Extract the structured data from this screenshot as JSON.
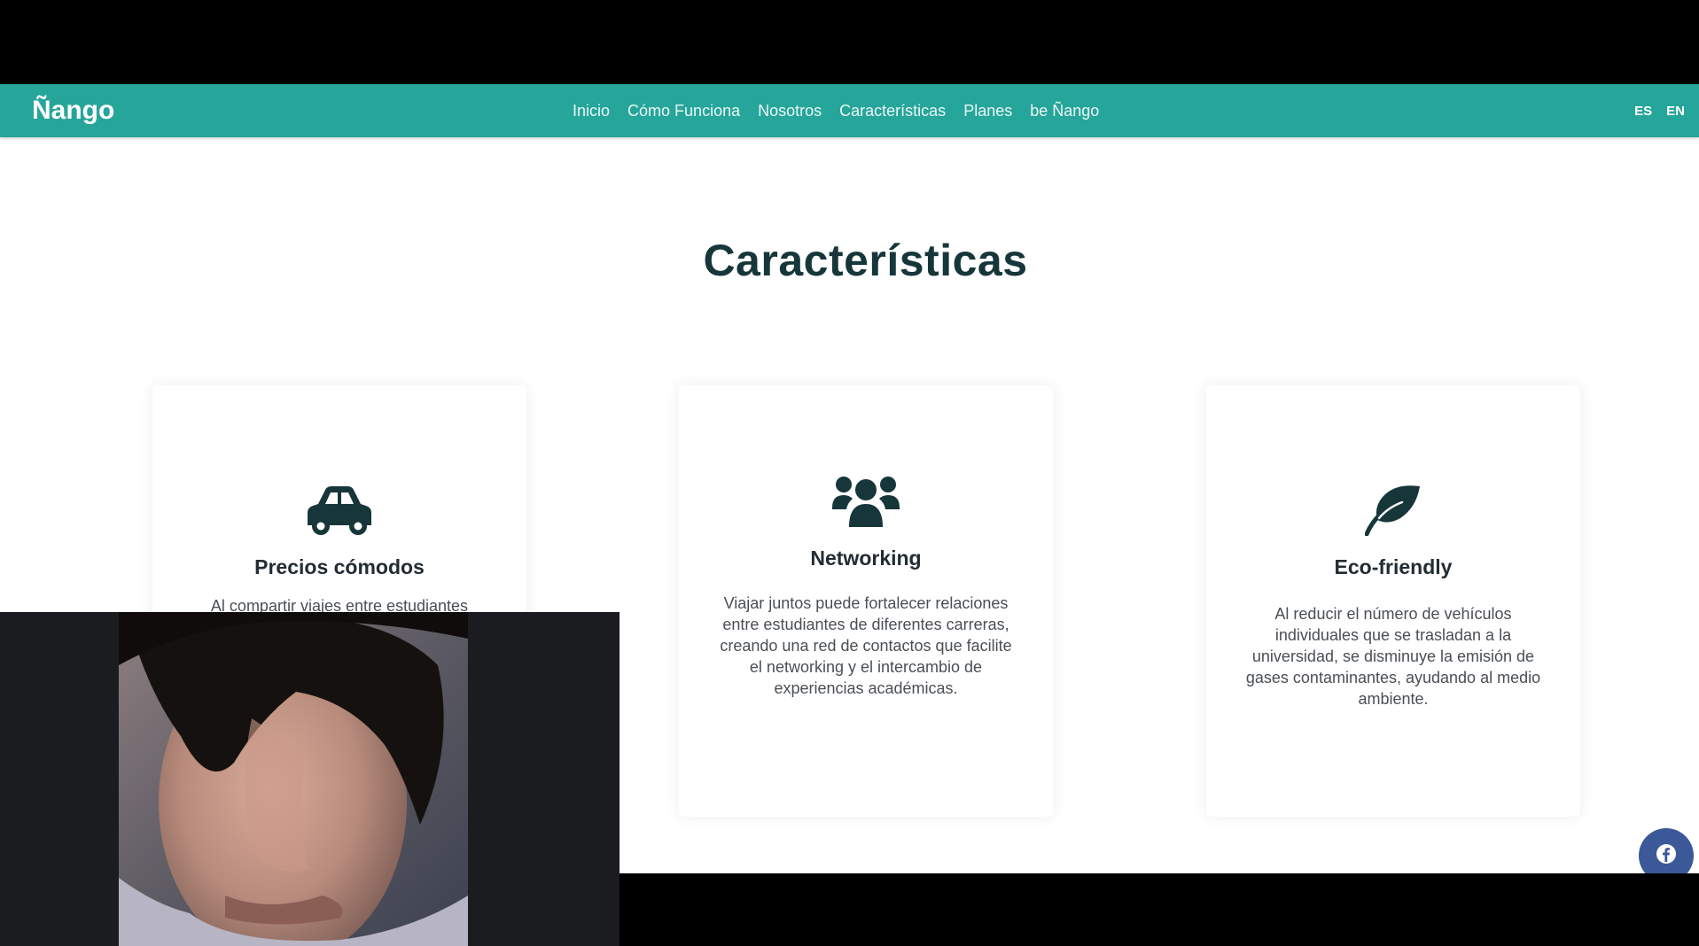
{
  "site": {
    "brand": "Ñango",
    "nav": [
      {
        "label": "Inicio"
      },
      {
        "label": "Cómo Funciona"
      },
      {
        "label": "Nosotros"
      },
      {
        "label": "Características"
      },
      {
        "label": "Planes"
      },
      {
        "label": "be Ñango"
      }
    ],
    "languages": [
      "ES",
      "EN"
    ],
    "accent_color": "#26a59a"
  },
  "features": {
    "title": "Características",
    "cards": [
      {
        "icon": "car-icon",
        "title": "Precios cómodos",
        "description": "Al compartir viajes entre estudiantes"
      },
      {
        "icon": "users-icon",
        "title": "Networking",
        "description": "Viajar juntos puede fortalecer relaciones entre estudiantes de diferentes carreras, creando una red de contactos que facilite el networking y el intercambio de experiencias académicas."
      },
      {
        "icon": "leaf-icon",
        "title": "Eco-friendly",
        "description": "Al reducir el número de vehículos individuales que se trasladan a la universidad, se disminuye la emisión de gases contaminantes, ayudando al medio ambiente."
      }
    ]
  },
  "social": [
    {
      "icon": "facebook-icon",
      "color": "#3b5998"
    },
    {
      "icon": "twitter-icon",
      "color": "#1da1f2"
    }
  ],
  "overlay": {
    "webcam": "webcam-feed"
  }
}
